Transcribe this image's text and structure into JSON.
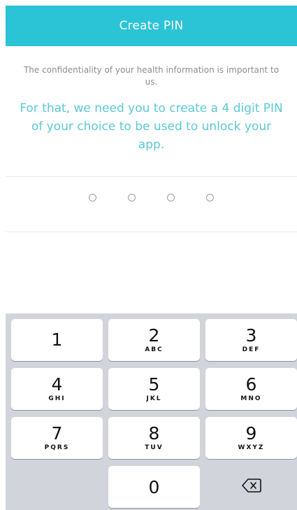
{
  "header": {
    "title": "Create PIN"
  },
  "intro": {
    "text": "The confidentiality of your health information is important to us."
  },
  "instruction": {
    "text": "For that, we need you to create a 4 digit PIN of your choice to be used to unlock your app."
  },
  "pin": {
    "slots": 4,
    "entered": 0
  },
  "keypad": {
    "keys": [
      {
        "number": "1",
        "letters": ""
      },
      {
        "number": "2",
        "letters": "ABC"
      },
      {
        "number": "3",
        "letters": "DEF"
      },
      {
        "number": "4",
        "letters": "GHI"
      },
      {
        "number": "5",
        "letters": "JKL"
      },
      {
        "number": "6",
        "letters": "MNO"
      },
      {
        "number": "7",
        "letters": "PQRS"
      },
      {
        "number": "8",
        "letters": "TUV"
      },
      {
        "number": "9",
        "letters": "WXYZ"
      },
      {
        "number": "0",
        "letters": ""
      }
    ],
    "delete_icon": "backspace-icon"
  }
}
